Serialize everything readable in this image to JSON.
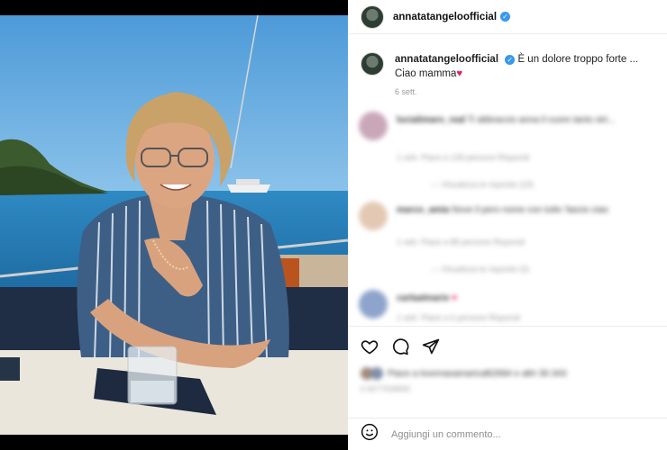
{
  "post": {
    "username": "annatatangeloofficial",
    "verified_glyph": "✓",
    "image_alt": "Woman smiling at a table on a boat by the sea"
  },
  "caption": {
    "username": "annatatangeloofficial",
    "line1": "È un dolore troppo forte ...",
    "line2": "Ciao mamma",
    "heart": "♥",
    "time": "6 sett."
  },
  "comments": [
    {
      "name": "lucialimaro_real",
      "text": "Ti abbraccio anna il cuore tanto stri...",
      "meta": "1 sett.   Piace a 128 persone   Rispondi",
      "replies": "— Visualizza le risposte (19)",
      "avatar_color": "#c9a7b9"
    },
    {
      "name": "marco_amia",
      "text": "Nove il pero nome con tutto 'lascio ciao",
      "meta": "1 sett.   Piace a 88 persone   Rispondi",
      "replies": "— Visualizza le risposte (3)",
      "avatar_color": "#e3c9b4"
    },
    {
      "name": "carlaalmarie",
      "text": "♥",
      "meta": "1 sett.   Piace a 6 persone   Rispondi",
      "replies": "",
      "avatar_color": "#8ea4cc"
    }
  ],
  "actions": {
    "like_icon": "heart-icon",
    "comment_icon": "comment-icon",
    "share_icon": "share-icon"
  },
  "likes": {
    "text": "Piace a lovemaxamaricalli2684 e altri 30.343",
    "date": "6 SETTEMBRE"
  },
  "add_comment": {
    "placeholder": "Aggiungi un commento...",
    "emoji_icon": "emoji-icon"
  },
  "colors": {
    "verified": "#3897f0",
    "heart": "#e0245e",
    "sea": "#2a7ab8",
    "sky": "#5aa0d6"
  }
}
